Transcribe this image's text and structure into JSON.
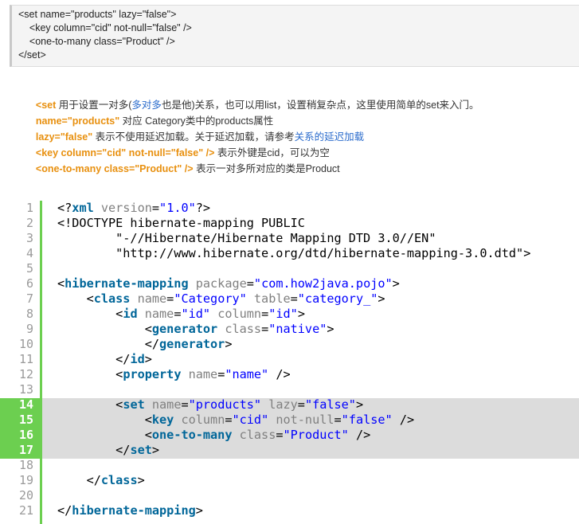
{
  "snippet": {
    "lines": [
      "<set name=\"products\" lazy=\"false\">",
      "    <key column=\"cid\" not-null=\"false\" />",
      "    <one-to-many class=\"Product\" />",
      "</set>"
    ]
  },
  "explanation": [
    {
      "code": "<set",
      "t1": " 用于设置一对多(",
      "link": "多对多",
      "t2": "也是他)关系，也可以用list，设置稍复杂点，这里使用简单的set来入门。"
    },
    {
      "code": "name=\"products\"",
      "t1": " 对应 Category类中的products属性"
    },
    {
      "code": "lazy=\"false\"",
      "t1": " 表示不使用延迟加载。关于延迟加载，请参考",
      "link": "关系的延迟加载"
    },
    {
      "code": "<key column=\"cid\" not-null=\"false\" />",
      "t1": " 表示外键是cid，可以为空"
    },
    {
      "code": "<one-to-many class=\"Product\" />",
      "t1": " 表示一对多所对应的类是Product"
    }
  ],
  "colors": {
    "highlight_code": "#e8900f",
    "link": "#2a6bcc",
    "gutter_green": "#6ccf50",
    "highlight_band": "#dcdcdc"
  },
  "code": {
    "line_numbers": [
      "1",
      "2",
      "3",
      "4",
      "5",
      "6",
      "7",
      "8",
      "9",
      "10",
      "11",
      "12",
      "13",
      "14",
      "15",
      "16",
      "17",
      "18",
      "19",
      "20",
      "21"
    ],
    "highlighted_lines": [
      14,
      15,
      16,
      17
    ],
    "l1": {
      "a": "<?",
      "b": "xml",
      "c": " version",
      "d": "=",
      "e": "\"1.0\"",
      "f": "?>"
    },
    "l2": "<!DOCTYPE hibernate-mapping PUBLIC",
    "l3": "        \"-//Hibernate/Hibernate Mapping DTD 3.0//EN\"",
    "l4": "        \"http://www.hibernate.org/dtd/hibernate-mapping-3.0.dtd\">",
    "l6": {
      "open": "<",
      "tag": "hibernate-mapping",
      "a1": " package",
      "eq": "=",
      "v1": "\"com.how2java.pojo\"",
      "close": ">"
    },
    "l7": {
      "ind": "    ",
      "open": "<",
      "tag": "class",
      "a1": " name",
      "eq1": "=",
      "v1": "\"Category\"",
      "a2": " table",
      "eq2": "=",
      "v2": "\"category_\"",
      "close": ">"
    },
    "l8": {
      "ind": "        ",
      "open": "<",
      "tag": "id",
      "a1": " name",
      "eq1": "=",
      "v1": "\"id\"",
      "a2": " column",
      "eq2": "=",
      "v2": "\"id\"",
      "close": ">"
    },
    "l9": {
      "ind": "            ",
      "open": "<",
      "tag": "generator",
      "a1": " class",
      "eq1": "=",
      "v1": "\"native\"",
      "close": ">"
    },
    "l10": {
      "ind": "            ",
      "open": "</",
      "tag": "generator",
      "close": ">"
    },
    "l11": {
      "ind": "        ",
      "open": "</",
      "tag": "id",
      "close": ">"
    },
    "l12": {
      "ind": "        ",
      "open": "<",
      "tag": "property",
      "a1": " name",
      "eq1": "=",
      "v1": "\"name\"",
      "close": " />"
    },
    "l14": {
      "ind": "        ",
      "open": "<",
      "tag": "set",
      "a1": " name",
      "eq1": "=",
      "v1": "\"products\"",
      "a2": " lazy",
      "eq2": "=",
      "v2": "\"false\"",
      "close": ">"
    },
    "l15": {
      "ind": "            ",
      "open": "<",
      "tag": "key",
      "a1": " column",
      "eq1": "=",
      "v1": "\"cid\"",
      "a2": " not-null",
      "eq2": "=",
      "v2": "\"false\"",
      "close": " />"
    },
    "l16": {
      "ind": "            ",
      "open": "<",
      "tag": "one-to-many",
      "a1": " class",
      "eq1": "=",
      "v1": "\"Product\"",
      "close": " />"
    },
    "l17": {
      "ind": "        ",
      "open": "</",
      "tag": "set",
      "close": ">"
    },
    "l19": {
      "ind": "    ",
      "open": "</",
      "tag": "class",
      "close": ">"
    },
    "l21": {
      "open": "</",
      "tag": "hibernate-mapping",
      "close": ">"
    }
  }
}
